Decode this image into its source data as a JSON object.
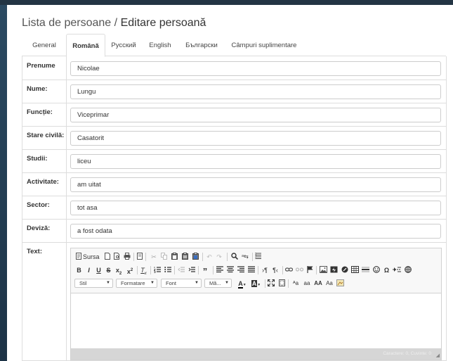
{
  "header": {
    "breadcrumb_parent": "Lista de persoane",
    "separator": "/",
    "current": "Editare persoană"
  },
  "tabs": [
    {
      "label": "General",
      "active": false
    },
    {
      "label": "Română",
      "active": true
    },
    {
      "label": "Русский",
      "active": false
    },
    {
      "label": "English",
      "active": false
    },
    {
      "label": "Български",
      "active": false
    },
    {
      "label": "Câmpuri suplimentare",
      "active": false
    }
  ],
  "fields": [
    {
      "label": "Prenume",
      "value": "Nicolae"
    },
    {
      "label": "Nume:",
      "value": "Lungu"
    },
    {
      "label": "Funcție:",
      "value": "Viceprimar"
    },
    {
      "label": "Stare civilă:",
      "value": "Casatorit"
    },
    {
      "label": "Studii:",
      "value": "liceu"
    },
    {
      "label": "Activitate:",
      "value": "am uitat"
    },
    {
      "label": "Sector:",
      "value": "tot asa"
    },
    {
      "label": "Deviză:",
      "value": "a fost odata"
    }
  ],
  "text_field": {
    "label": "Text:"
  },
  "editor": {
    "source_label": "Sursa",
    "combos": {
      "style": "Stil",
      "format": "Formatare",
      "font": "Font",
      "size": "Mă..."
    },
    "status": "Caractere: 0, Cuvinte: 0",
    "icons": [
      "source-icon",
      "new-page-icon",
      "preview-icon",
      "print-icon",
      "templates-icon",
      "cut-icon",
      "copy-icon",
      "paste-icon",
      "paste-text-icon",
      "paste-word-icon",
      "undo-icon",
      "redo-icon",
      "find-icon",
      "replace-icon",
      "select-all-icon",
      "bold-icon",
      "italic-icon",
      "underline-icon",
      "strike-icon",
      "subscript-icon",
      "superscript-icon",
      "remove-format-icon",
      "numbered-list-icon",
      "bulleted-list-icon",
      "outdent-icon",
      "indent-icon",
      "blockquote-icon",
      "align-left-icon",
      "align-center-icon",
      "align-right-icon",
      "justify-icon",
      "ltr-icon",
      "rtl-icon",
      "link-icon",
      "unlink-icon",
      "anchor-icon",
      "image-icon",
      "flash-icon",
      "youtube-icon",
      "table-icon",
      "horizontal-rule-icon",
      "smiley-icon",
      "special-char-icon",
      "page-break-icon",
      "iframe-icon",
      "text-color-icon",
      "bg-color-icon",
      "maximize-icon",
      "show-blocks-icon"
    ]
  }
}
